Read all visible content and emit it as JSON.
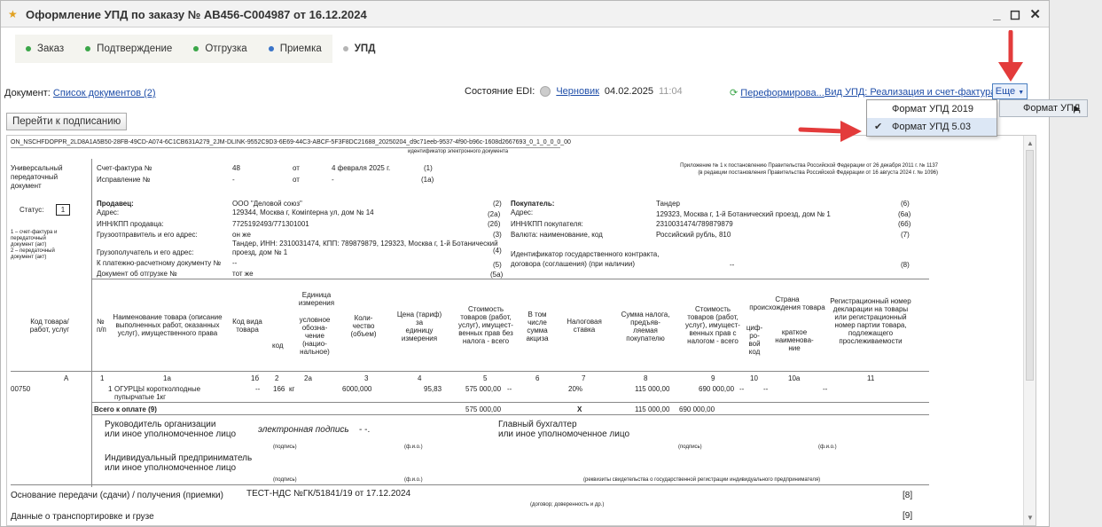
{
  "window": {
    "title": "Оформление УПД по заказу № АВ456-С004987 от 16.12.2024",
    "controls": "_ ◻ ✕"
  },
  "tabs": [
    {
      "label": "Заказ",
      "color": "#3aa648"
    },
    {
      "label": "Подтверждение",
      "color": "#3aa648"
    },
    {
      "label": "Отгрузка",
      "color": "#3aa648"
    },
    {
      "label": "Приемка",
      "color": "#3a74c8"
    },
    {
      "label": "УПД",
      "color": "#b5b5b5"
    }
  ],
  "toolbar": {
    "doc_label": "Документ:",
    "doc_link": "Список документов (2)",
    "edi_label": "Состояние EDI:",
    "edi_state": "Черновик",
    "edi_date": "04.02.2025",
    "edi_time": "11:04",
    "reform": "Переформирова...",
    "vid": "Вид УПД: Реализация и счет-фактура",
    "more": "Еще",
    "sign_button": "Перейти к подписанию"
  },
  "menu": {
    "items": [
      "Формат УПД 2019",
      "Формат УПД 5.03"
    ],
    "checked": "✔",
    "submenu": "Формат УПД",
    "submenu_arrow": "▶"
  },
  "doc": {
    "file_id": "ON_NSCHFDOPPR_2LD8A1A5B50-28FB-49CD-A074-6C1CB631A279_2JM-DLINK-9552C9D3-6E69-44C3-ABCF-5F3F8DC21688_20250204_d9c71eeb-9537-4f90-b96c-1608d2667693_0_1_0_0_0_00",
    "file_id_caption": "идентификатор электронного документа",
    "left_title": [
      "Универсальный",
      "передаточный",
      "документ"
    ],
    "status_label": "Статус:",
    "status_value": "1",
    "status_note": [
      "1 – счет-фактура и",
      "передаточный",
      "документ (акт)",
      "2 – передаточный",
      "документ (акт)"
    ],
    "sf_label": "Счет-фактура №",
    "sf_num": "48",
    "sf_ot": "от",
    "sf_date": "4 февраля 2025 г.",
    "sf_code": "(1)",
    "isp_label": "Исправление №",
    "isp_num": "-",
    "isp_ot": "от",
    "isp_date": "-",
    "isp_code": "(1а)",
    "appendix1": "Приложение № 1 к постановлению Правительства Российской Федерации от 26 декабря 2011 г. № 1137",
    "appendix2": "(в редакции постановления Правительства Российской Федерации от 16 августа 2024 г. № 1096)",
    "left_rows": [
      {
        "l": "Продавец:",
        "v": "ООО \"Деловой союз\"",
        "c": "(2)"
      },
      {
        "l": "Адрес:",
        "v": "129344, Москва г, Комintерна ул, дом № 14",
        "c": "(2а)"
      },
      {
        "l": "ИНН/КПП продавца:",
        "v": "7725192493/771301001",
        "c": "(2б)"
      },
      {
        "l": "Грузоотправитель и его адрес:",
        "v": "он же",
        "c": "(3)"
      },
      {
        "l": "",
        "v": "Тандер, ИНН: 2310031474, КПП: 789879879, 129323, Москва г, 1-й Ботанический",
        "c": ""
      },
      {
        "l": "Грузополучатель и его адрес:",
        "v": "проезд, дом № 1",
        "c": "(4)"
      },
      {
        "l": "К платежно-расчетному документу №",
        "v": "--",
        "c": "(5)"
      },
      {
        "l": "Документ об отгрузке №",
        "v": "тот же",
        "c": "(5а)"
      }
    ],
    "right_rows": [
      {
        "l": "Покупатель:",
        "v": "Тандер",
        "c": "(6)"
      },
      {
        "l": "Адрес:",
        "v": "129323, Москва г, 1-й Ботанический проезд, дом № 1",
        "c": "(6а)"
      },
      {
        "l": "ИНН/КПП покупателя:",
        "v": "2310031474/789879879",
        "c": "(6б)"
      },
      {
        "l": "Валюта: наименование, код",
        "v": "Российский рубль, 810",
        "c": "(7)"
      },
      {
        "l": "Идентификатор государственного контракта,",
        "v": "",
        "c": ""
      },
      {
        "l": "договора (соглашения) (при наличии)",
        "v": "--",
        "c": "(8)"
      }
    ],
    "headers": {
      "code": [
        "Код товара/",
        "работ, услуг"
      ],
      "num": [
        "№",
        "п/п"
      ],
      "name": [
        "Наименование товара (описание",
        "выполненных работ, оказанных",
        "услуг), имущественного права"
      ],
      "kind": [
        "Код вида",
        "товара"
      ],
      "unit": [
        "Единица",
        "измерения"
      ],
      "ucode": "код",
      "uname": [
        "условное",
        "обозна-",
        "чение",
        "(нацио-",
        "нальное)"
      ],
      "qty": [
        "Коли-",
        "чество",
        "(объем)"
      ],
      "price": [
        "Цена (тариф)",
        "за",
        "единицу",
        "измерения"
      ],
      "cost": [
        "Стоимость",
        "товаров (работ,",
        "услуг), имущест-",
        "венных прав без",
        "налога - всего"
      ],
      "excise": [
        "В том",
        "числе",
        "сумма",
        "акциза"
      ],
      "rate": [
        "Налоговая",
        "ставка"
      ],
      "tax": [
        "Сумма налога,",
        "предъяв-",
        "ляемая",
        "покупателю"
      ],
      "costtax": [
        "Стоимость",
        "товаров (работ,",
        "услуг), имущест-",
        "венных прав с",
        "налогом - всего"
      ],
      "country": [
        "Страна",
        "происхождения товара"
      ],
      "ccode": [
        "циф-",
        "ро-",
        "вой",
        "код"
      ],
      "cname": [
        "краткое",
        "наименова-",
        "ние"
      ],
      "reg": [
        "Регистрационный номер",
        "декларации на товары",
        "или регистрационный",
        "номер партии товара,",
        "подлежащего",
        "прослеживаемости"
      ]
    },
    "colnums": [
      "А",
      "1",
      "1а",
      "1б",
      "2",
      "2а",
      "3",
      "4",
      "5",
      "6",
      "7",
      "8",
      "9",
      "10",
      "10а",
      "11"
    ],
    "row": {
      "code": "00750",
      "num": "1",
      "name": "ОГУРЦЫ коротколподные",
      "name2": "пупырчатые 1кг",
      "kind": "--",
      "ucode": "166",
      "uname": "кг",
      "qty": "6000,000",
      "price": "95,83",
      "cost": "575 000,00",
      "excise": "--",
      "rate": "20%",
      "tax": "115 000,00",
      "costtax": "690 000,00",
      "ccode": "--",
      "cname": "--",
      "reg": "--"
    },
    "total": {
      "label": "Всего к оплате (9)",
      "cost": "575 000,00",
      "x": "X",
      "tax": "115 000,00",
      "costtax": "690 000,00"
    },
    "sign": {
      "head": [
        "Руководитель организации",
        "или иное уполномоченное лицо"
      ],
      "esig": "электронная подпись",
      "dash": "- -.",
      "podpis": "(подпись)",
      "fio": "(ф.и.о.)",
      "acc": [
        "Главный бухгалтер",
        "или иное уполномоченное лицо"
      ],
      "ip": [
        "Индивидуальный предприниматель",
        "или иное уполномоченное лицо"
      ],
      "reqs": "(реквизиты свидетельства о государственной регистрации индивидуального предпринимателя)"
    },
    "basis_label": "Основание передачи (сдачи) / получения (приемки)",
    "basis_value": "ТЕСТ-НДС №ГК/51841/19 от 17.12.2024",
    "basis_code": "[8]",
    "basis_caption": "(договор; доверенность и др.)",
    "transport": "Данные о транспортировке и грузе",
    "transport_code": "[9]"
  }
}
